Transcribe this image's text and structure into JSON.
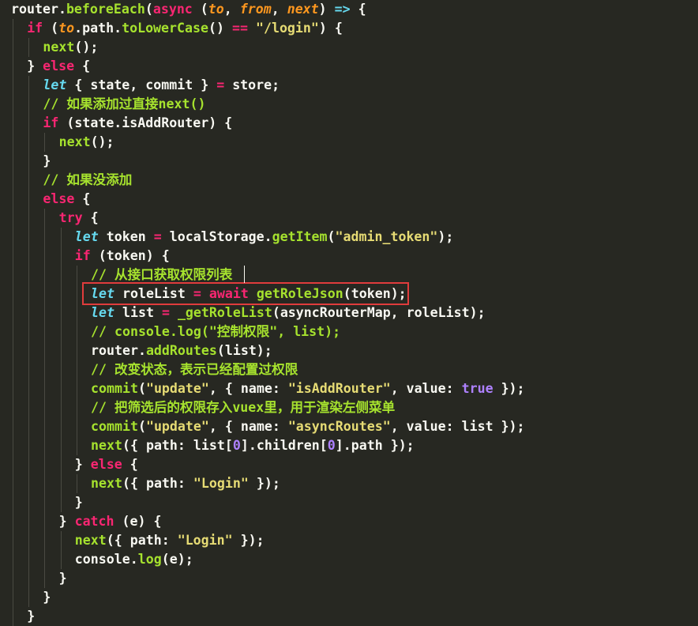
{
  "colors": {
    "background": "#272822",
    "default": "#f8f8f2",
    "keyword": "#f92672",
    "function": "#a6e22e",
    "string": "#e6db74",
    "param": "#fd971f",
    "storage": "#66d9ef",
    "constant": "#ae81ff",
    "comment": "#a6e22e",
    "highlight_border": "#e03c3c",
    "indent_guide": "#4a4a42"
  },
  "lines": [
    {
      "indent": 0,
      "tokens": [
        [
          "router.",
          "d"
        ],
        [
          "beforeEach",
          "f"
        ],
        [
          "(",
          "d"
        ],
        [
          "async",
          "k"
        ],
        [
          " (",
          "d"
        ],
        [
          "to",
          "p"
        ],
        [
          ", ",
          "d"
        ],
        [
          "from",
          "p"
        ],
        [
          ", ",
          "d"
        ],
        [
          "next",
          "p"
        ],
        [
          ") ",
          "d"
        ],
        [
          "=>",
          "s"
        ],
        [
          " {",
          "d"
        ]
      ]
    },
    {
      "indent": 1,
      "tokens": [
        [
          "if",
          "k"
        ],
        [
          " (",
          "d"
        ],
        [
          "to",
          "p"
        ],
        [
          ".path.",
          "d"
        ],
        [
          "toLowerCase",
          "f"
        ],
        [
          "() ",
          "d"
        ],
        [
          "==",
          "k"
        ],
        [
          " ",
          "d"
        ],
        [
          "\"/login\"",
          "str"
        ],
        [
          ") {",
          "d"
        ]
      ]
    },
    {
      "indent": 2,
      "tokens": [
        [
          "next",
          "f"
        ],
        [
          "();",
          "d"
        ]
      ]
    },
    {
      "indent": 1,
      "tokens": [
        [
          "} ",
          "d"
        ],
        [
          "else",
          "k"
        ],
        [
          " {",
          "d"
        ]
      ]
    },
    {
      "indent": 2,
      "tokens": [
        [
          "let",
          "si"
        ],
        [
          " { state, commit } ",
          "d"
        ],
        [
          "=",
          "k"
        ],
        [
          " store;",
          "d"
        ]
      ]
    },
    {
      "indent": 2,
      "tokens": [
        [
          "// 如果添加过直接next()",
          "c"
        ]
      ]
    },
    {
      "indent": 2,
      "tokens": [
        [
          "if",
          "k"
        ],
        [
          " (state.isAddRouter) {",
          "d"
        ]
      ]
    },
    {
      "indent": 3,
      "tokens": [
        [
          "next",
          "f"
        ],
        [
          "();",
          "d"
        ]
      ]
    },
    {
      "indent": 2,
      "tokens": [
        [
          "}",
          "d"
        ]
      ]
    },
    {
      "indent": 2,
      "tokens": [
        [
          "// 如果没添加",
          "c"
        ]
      ]
    },
    {
      "indent": 2,
      "tokens": [
        [
          "else",
          "k"
        ],
        [
          " {",
          "d"
        ]
      ]
    },
    {
      "indent": 3,
      "tokens": [
        [
          "try",
          "k"
        ],
        [
          " {",
          "d"
        ]
      ]
    },
    {
      "indent": 4,
      "tokens": [
        [
          "let",
          "si"
        ],
        [
          " token ",
          "d"
        ],
        [
          "=",
          "k"
        ],
        [
          " localStorage.",
          "d"
        ],
        [
          "getItem",
          "f"
        ],
        [
          "(",
          "d"
        ],
        [
          "\"admin_token\"",
          "str"
        ],
        [
          ");",
          "d"
        ]
      ]
    },
    {
      "indent": 4,
      "tokens": [
        [
          "if",
          "k"
        ],
        [
          " (token) {",
          "d"
        ]
      ]
    },
    {
      "indent": 5,
      "tokens": [
        [
          "// 从接口获取权限列表",
          "c"
        ]
      ]
    },
    {
      "indent": 5,
      "tokens": [
        [
          "let",
          "si"
        ],
        [
          " roleList ",
          "d"
        ],
        [
          "=",
          "k"
        ],
        [
          " ",
          "d"
        ],
        [
          "await",
          "k"
        ],
        [
          " ",
          "d"
        ],
        [
          "getRoleJson",
          "f"
        ],
        [
          "(token);",
          "d"
        ]
      ]
    },
    {
      "indent": 5,
      "tokens": [
        [
          "let",
          "si"
        ],
        [
          " list ",
          "d"
        ],
        [
          "=",
          "k"
        ],
        [
          " ",
          "d"
        ],
        [
          "_getRoleList",
          "f"
        ],
        [
          "(asyncRouterMap, roleList);",
          "d"
        ]
      ]
    },
    {
      "indent": 5,
      "tokens": [
        [
          "// console.log(\"控制权限\", list);",
          "c"
        ]
      ]
    },
    {
      "indent": 5,
      "tokens": [
        [
          "router.",
          "d"
        ],
        [
          "addRoutes",
          "f"
        ],
        [
          "(list);",
          "d"
        ]
      ]
    },
    {
      "indent": 5,
      "tokens": [
        [
          "// 改变状态，表示已经配置过权限",
          "c"
        ]
      ]
    },
    {
      "indent": 5,
      "tokens": [
        [
          "commit",
          "f"
        ],
        [
          "(",
          "d"
        ],
        [
          "\"update\"",
          "str"
        ],
        [
          ", { ",
          "d"
        ],
        [
          "name",
          "d"
        ],
        [
          ": ",
          "d"
        ],
        [
          "\"isAddRouter\"",
          "str"
        ],
        [
          ", ",
          "d"
        ],
        [
          "value",
          "d"
        ],
        [
          ": ",
          "d"
        ],
        [
          "true",
          "const"
        ],
        [
          " });",
          "d"
        ]
      ]
    },
    {
      "indent": 5,
      "tokens": [
        [
          "// 把筛选后的权限存入vuex里，用于渲染左侧菜单",
          "c"
        ]
      ]
    },
    {
      "indent": 5,
      "tokens": [
        [
          "commit",
          "f"
        ],
        [
          "(",
          "d"
        ],
        [
          "\"update\"",
          "str"
        ],
        [
          ", { ",
          "d"
        ],
        [
          "name",
          "d"
        ],
        [
          ": ",
          "d"
        ],
        [
          "\"asyncRoutes\"",
          "str"
        ],
        [
          ", ",
          "d"
        ],
        [
          "value",
          "d"
        ],
        [
          ": list });",
          "d"
        ]
      ]
    },
    {
      "indent": 5,
      "tokens": [
        [
          "next",
          "f"
        ],
        [
          "({ ",
          "d"
        ],
        [
          "path",
          "d"
        ],
        [
          ": list[",
          "d"
        ],
        [
          "0",
          "const"
        ],
        [
          "].children[",
          "d"
        ],
        [
          "0",
          "const"
        ],
        [
          "].path });",
          "d"
        ]
      ]
    },
    {
      "indent": 4,
      "tokens": [
        [
          "} ",
          "d"
        ],
        [
          "else",
          "k"
        ],
        [
          " {",
          "d"
        ]
      ]
    },
    {
      "indent": 5,
      "tokens": [
        [
          "next",
          "f"
        ],
        [
          "({ ",
          "d"
        ],
        [
          "path",
          "d"
        ],
        [
          ": ",
          "d"
        ],
        [
          "\"Login\"",
          "str"
        ],
        [
          " });",
          "d"
        ]
      ]
    },
    {
      "indent": 4,
      "tokens": [
        [
          "}",
          "d"
        ]
      ]
    },
    {
      "indent": 3,
      "tokens": [
        [
          "} ",
          "d"
        ],
        [
          "catch",
          "k"
        ],
        [
          " (e) {",
          "d"
        ]
      ]
    },
    {
      "indent": 4,
      "tokens": [
        [
          "next",
          "f"
        ],
        [
          "({ ",
          "d"
        ],
        [
          "path",
          "d"
        ],
        [
          ": ",
          "d"
        ],
        [
          "\"Login\"",
          "str"
        ],
        [
          " });",
          "d"
        ]
      ]
    },
    {
      "indent": 4,
      "tokens": [
        [
          "console.",
          "d"
        ],
        [
          "log",
          "f"
        ],
        [
          "(e);",
          "d"
        ]
      ]
    },
    {
      "indent": 3,
      "tokens": [
        [
          "}",
          "d"
        ]
      ]
    },
    {
      "indent": 2,
      "tokens": [
        [
          "}",
          "d"
        ]
      ]
    },
    {
      "indent": 1,
      "tokens": [
        [
          "}",
          "d"
        ]
      ]
    }
  ],
  "highlighted_line_index": 15
}
